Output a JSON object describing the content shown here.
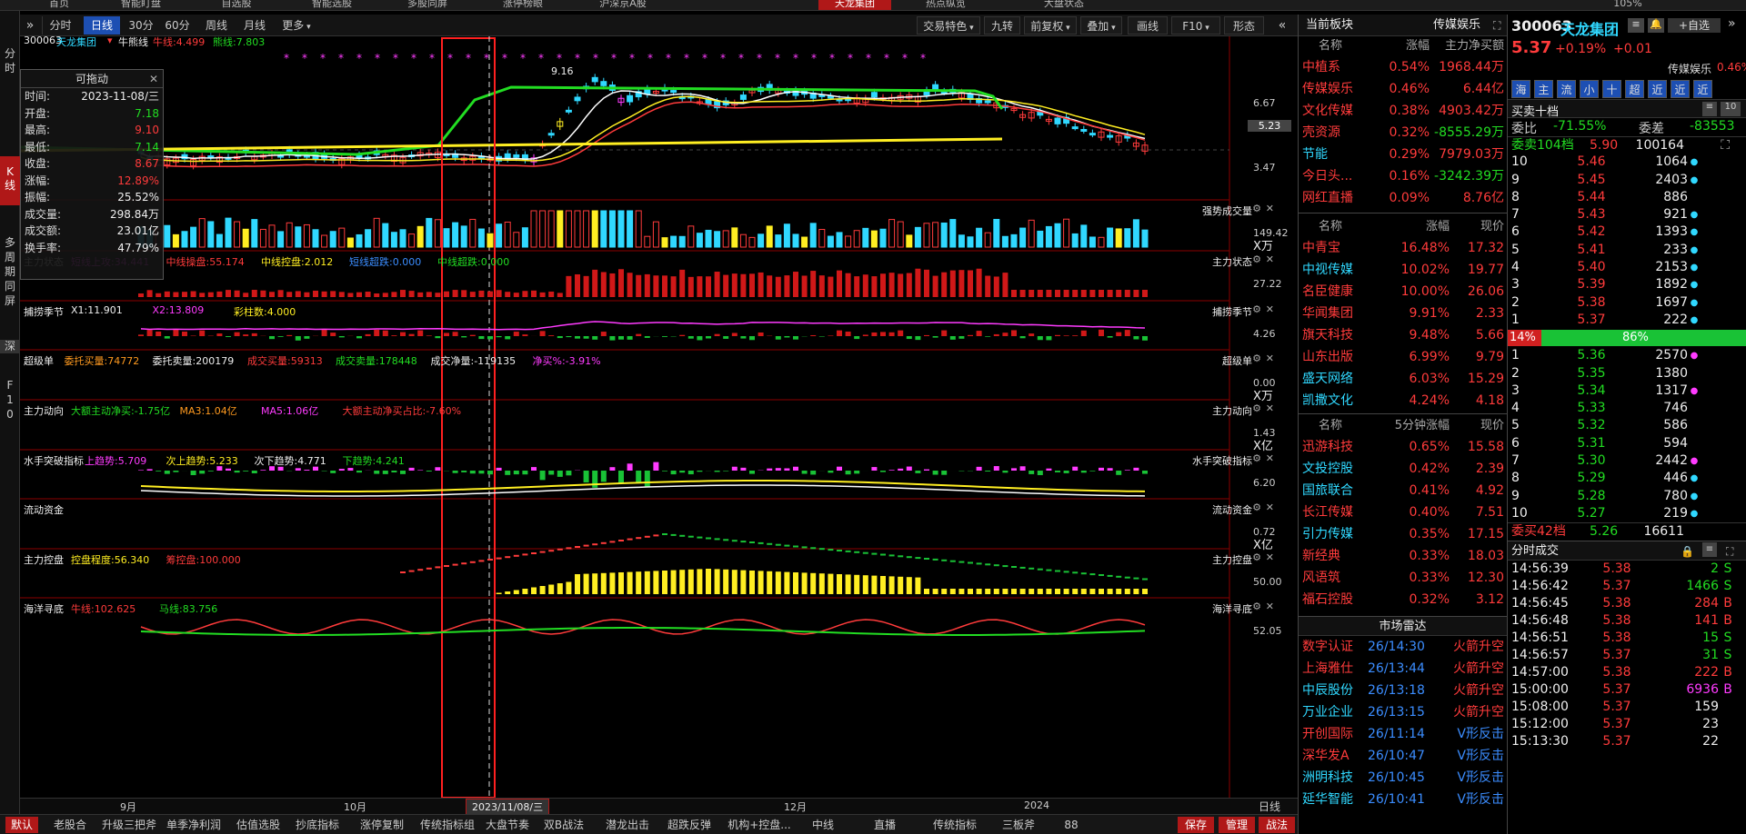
{
  "topnav": {
    "tabs": [
      "首页",
      "智能盯盘",
      "自选股",
      "智能选股",
      "多股同屏",
      "涨停榜眼",
      "沪深京A股",
      "天龙集团",
      "热点纵览",
      "大盘状态"
    ],
    "right_text": "105%"
  },
  "leftnav": {
    "items": [
      "分",
      "时",
      "K",
      "线",
      "多",
      "周",
      "期",
      "同",
      "屏",
      "深",
      "F",
      "1",
      "0"
    ]
  },
  "toolbar": {
    "expand": "»",
    "buttons": [
      "分时",
      "日线",
      "30分",
      "60分",
      "周线",
      "月线",
      "更多"
    ],
    "right": [
      "交易特色",
      "九转",
      "前复权",
      "叠加",
      "画线",
      "F10",
      "形态"
    ],
    "collapse": "«"
  },
  "chart": {
    "stock_header": {
      "code": "300063",
      "name": "天龙集团",
      "indicator": "牛熊线",
      "niu": "牛线:4.499",
      "xiong": "熊线:7.803"
    },
    "price_scale": [
      "6.67",
      "5.23",
      "3.47"
    ],
    "high_label": "9.16",
    "panels": [
      {
        "name": "强势成交量",
        "scale": [
          "149.42",
          "X万"
        ],
        "items": []
      },
      {
        "name": "主力状态",
        "scale": [
          "27.22"
        ],
        "items": [
          {
            "t": "主力状态",
            "c": "#eeeeee"
          },
          {
            "t": "短线上攻:34.441",
            "c": "#ff3bff"
          },
          {
            "t": "中线操盘:55.174",
            "c": "#ff3b3b"
          },
          {
            "t": "中线控盘:2.012",
            "c": "#ffee22"
          },
          {
            "t": "短线超跌:0.000",
            "c": "#3b8dff"
          },
          {
            "t": "中线超跌:0.000",
            "c": "#22dd22"
          }
        ]
      },
      {
        "name": "捕捞季节",
        "scale": [
          "4.26"
        ],
        "items": [
          {
            "t": "捕捞季节",
            "c": "#eeeeee"
          },
          {
            "t": "X1:11.901",
            "c": "#eeeeee"
          },
          {
            "t": "X2:13.809",
            "c": "#ff3bff"
          },
          {
            "t": "彩柱数:4.000",
            "c": "#ffee22"
          }
        ]
      },
      {
        "name": "超级单",
        "scale": [
          "0.00",
          "X万"
        ],
        "items": [
          {
            "t": "超级单",
            "c": "#eeeeee"
          },
          {
            "t": "委托买量:74772",
            "c": "#ff9a1f"
          },
          {
            "t": "委托卖量:200179",
            "c": "#eeeeee"
          },
          {
            "t": "成交买量:59313",
            "c": "#ff3b3b"
          },
          {
            "t": "成交卖量:178448",
            "c": "#22dd22"
          },
          {
            "t": "成交净量:-119135",
            "c": "#eeeeee"
          },
          {
            "t": "净买%:-3.91%",
            "c": "#ff3bff"
          }
        ]
      },
      {
        "name": "主力动向",
        "scale": [
          "1.43",
          "X亿"
        ],
        "items": [
          {
            "t": "主力动向",
            "c": "#eeeeee"
          },
          {
            "t": "大额主动净买:-1.75亿",
            "c": "#22dd22"
          },
          {
            "t": "MA3:1.04亿",
            "c": "#ff9a1f"
          },
          {
            "t": "MA5:1.06亿",
            "c": "#ff3bff"
          },
          {
            "t": "大额主动净买占比:-7.60%",
            "c": "#ff3b3b"
          }
        ]
      },
      {
        "name": "水手突破指标",
        "scale": [
          "6.20"
        ],
        "items": [
          {
            "t": "水手突破指标",
            "c": "#eeeeee"
          },
          {
            "t": "上趋势:5.709",
            "c": "#ff3bff"
          },
          {
            "t": "次上趋势:5.233",
            "c": "#ffee22"
          },
          {
            "t": "次下趋势:4.771",
            "c": "#eeeeee"
          },
          {
            "t": "下趋势:4.241",
            "c": "#22dd22"
          }
        ]
      },
      {
        "name": "流动资金",
        "scale": [
          "0.72",
          "X亿"
        ],
        "items": [
          {
            "t": "流动资金",
            "c": "#eeeeee"
          }
        ]
      },
      {
        "name": "主力控盘",
        "scale": [
          "50.00"
        ],
        "items": [
          {
            "t": "主力控盘",
            "c": "#eeeeee"
          },
          {
            "t": "控盘程度:56.340",
            "c": "#ffee22"
          },
          {
            "t": "筹控盘:100.000",
            "c": "#ff3b3b"
          }
        ]
      },
      {
        "name": "海洋寻底",
        "scale": [
          "52.05"
        ],
        "items": [
          {
            "t": "海洋寻底",
            "c": "#eeeeee"
          },
          {
            "t": "牛线:102.625",
            "c": "#ff3b3b"
          },
          {
            "t": "马线:83.756",
            "c": "#22dd22"
          }
        ]
      }
    ],
    "xaxis": [
      "9月",
      "10月",
      "2023/11/08/三",
      "12月",
      "2024"
    ]
  },
  "dragbox": {
    "title": "可拖动",
    "rows": [
      {
        "k": "时间:",
        "v": "2023-11-08/三",
        "c": "#eeeeee"
      },
      {
        "k": "开盘:",
        "v": "7.18",
        "c": "#22dd22"
      },
      {
        "k": "最高:",
        "v": "9.10",
        "c": "#ff3b3b"
      },
      {
        "k": "最低:",
        "v": "7.14",
        "c": "#22dd22"
      },
      {
        "k": "收盘:",
        "v": "8.67",
        "c": "#ff3b3b"
      },
      {
        "k": "涨幅:",
        "v": "12.89%",
        "c": "#ff3b3b"
      },
      {
        "k": "振幅:",
        "v": "25.52%",
        "c": "#eeeeee"
      },
      {
        "k": "成交量:",
        "v": "298.84万",
        "c": "#eeeeee"
      },
      {
        "k": "成交额:",
        "v": "23.01亿",
        "c": "#eeeeee"
      },
      {
        "k": "换手率:",
        "v": "47.79%",
        "c": "#eeeeee"
      }
    ]
  },
  "bottombar": {
    "right": "日线"
  },
  "funcbar": {
    "items": [
      "默认",
      "老股合",
      "升级三把斧",
      "单季净利润",
      "估值选股",
      "抄底指标",
      "涨停复制",
      "传统指标组",
      "大盘节奏",
      "双B战法",
      "潜龙出击",
      "超跌反弹",
      "机构+控盘...",
      "中线",
      "直播",
      "传统指标",
      "三板斧",
      "88"
    ],
    "right": [
      "保存",
      "管理",
      "战法"
    ]
  },
  "sector": {
    "title": "当前板块",
    "current": "传媒娱乐",
    "headers": [
      "名称",
      "涨幅",
      "主力净买额"
    ],
    "rows": [
      {
        "n": "中植系",
        "p": "0.54%",
        "v": "1968.44万",
        "nc": "#ff3b3b",
        "vc": "#ff3b3b"
      },
      {
        "n": "传媒娱乐",
        "p": "0.46%",
        "v": "6.44亿",
        "nc": "#ff3b3b",
        "vc": "#ff3b3b"
      },
      {
        "n": "文化传媒",
        "p": "0.38%",
        "v": "4903.42万",
        "nc": "#ff3b3b",
        "vc": "#ff3b3b"
      },
      {
        "n": "壳资源",
        "p": "0.32%",
        "v": "-8555.29万",
        "nc": "#ff3b3b",
        "vc": "#22dd22"
      },
      {
        "n": "节能",
        "p": "0.29%",
        "v": "7979.03万",
        "nc": "#30d8ff",
        "vc": "#ff3b3b"
      },
      {
        "n": "今日头...",
        "p": "0.16%",
        "v": "-3242.39万",
        "nc": "#ff3b3b",
        "vc": "#22dd22"
      },
      {
        "n": "网红直播",
        "p": "0.09%",
        "v": "8.76亿",
        "nc": "#ff3b3b",
        "vc": "#ff3b3b"
      }
    ]
  },
  "stocks": {
    "headers": [
      "名称",
      "涨幅",
      "现价"
    ],
    "rows": [
      {
        "n": "中青宝",
        "p": "16.48%",
        "v": "17.32",
        "nc": "#ff3b3b"
      },
      {
        "n": "中视传媒",
        "p": "10.02%",
        "v": "19.77",
        "nc": "#30d8ff"
      },
      {
        "n": "名臣健康",
        "p": "10.00%",
        "v": "26.06",
        "nc": "#ff3b3b"
      },
      {
        "n": "华闻集团",
        "p": "9.91%",
        "v": "2.33",
        "nc": "#ff3b3b"
      },
      {
        "n": "旗天科技",
        "p": "9.48%",
        "v": "5.66",
        "nc": "#ff3b3b"
      },
      {
        "n": "山东出版",
        "p": "6.99%",
        "v": "9.79",
        "nc": "#ff3b3b"
      },
      {
        "n": "盛天网络",
        "p": "6.03%",
        "v": "15.29",
        "nc": "#30d8ff"
      },
      {
        "n": "凯撒文化",
        "p": "4.24%",
        "v": "4.18",
        "nc": "#30d8ff"
      }
    ]
  },
  "fivemin": {
    "headers": [
      "名称",
      "5分钟涨幅",
      "现价"
    ],
    "rows": [
      {
        "n": "迅游科技",
        "p": "0.65%",
        "v": "15.58",
        "nc": "#ff3b3b"
      },
      {
        "n": "文投控股",
        "p": "0.42%",
        "v": "2.39",
        "nc": "#30d8ff"
      },
      {
        "n": "国旅联合",
        "p": "0.41%",
        "v": "4.92",
        "nc": "#30d8ff"
      },
      {
        "n": "长江传媒",
        "p": "0.40%",
        "v": "7.51",
        "nc": "#ff3b3b"
      },
      {
        "n": "引力传媒",
        "p": "0.35%",
        "v": "17.15",
        "nc": "#30d8ff"
      },
      {
        "n": "新经典",
        "p": "0.33%",
        "v": "18.03",
        "nc": "#ff3b3b"
      },
      {
        "n": "风语筑",
        "p": "0.33%",
        "v": "12.30",
        "nc": "#ff3b3b"
      },
      {
        "n": "福石控股",
        "p": "0.32%",
        "v": "3.12",
        "nc": "#ff3b3b"
      }
    ]
  },
  "radar": {
    "title": "市场雷达",
    "rows": [
      {
        "n": "数字认证",
        "t": "26/14:30",
        "e": "火箭升空",
        "nc": "#ff3b3b",
        "ec": "#ff3b3b"
      },
      {
        "n": "上海雅仕",
        "t": "26/13:44",
        "e": "火箭升空",
        "nc": "#ff3b3b",
        "ec": "#ff3b3b"
      },
      {
        "n": "中辰股份",
        "t": "26/13:18",
        "e": "火箭升空",
        "nc": "#30d8ff",
        "ec": "#ff3b3b"
      },
      {
        "n": "万业企业",
        "t": "26/13:15",
        "e": "火箭升空",
        "nc": "#30d8ff",
        "ec": "#ff3b3b"
      },
      {
        "n": "开创国际",
        "t": "26/11:14",
        "e": "V形反击",
        "nc": "#ff3b3b",
        "ec": "#3b8dff"
      },
      {
        "n": "深华发A",
        "t": "26/10:47",
        "e": "V形反击",
        "nc": "#ff3b3b",
        "ec": "#3b8dff"
      },
      {
        "n": "洲明科技",
        "t": "26/10:45",
        "e": "V形反击",
        "nc": "#30d8ff",
        "ec": "#3b8dff"
      },
      {
        "n": "延华智能",
        "t": "26/10:41",
        "e": "V形反击",
        "nc": "#30d8ff",
        "ec": "#3b8dff"
      }
    ]
  },
  "quote": {
    "code": "300063",
    "name": "天龙集团",
    "price": "5.37",
    "change_pct": "+0.19%",
    "change": "+0.01",
    "sector": "传媒娱乐",
    "sector_pct": "0.46%",
    "add": "+自选",
    "mini_buttons": [
      "海",
      "主",
      "流",
      "小",
      "十",
      "超",
      "近",
      "近",
      "近"
    ],
    "tenlevel": "买卖十档",
    "weibi_k": "委比",
    "weibi": "-71.55%",
    "weicha_k": "委差",
    "weicha": "-83553",
    "sell_summary": {
      "k": "委卖104档",
      "p": "5.90",
      "v": "100164"
    },
    "sells": [
      {
        "l": "10",
        "p": "5.46",
        "v": "1064"
      },
      {
        "l": "9",
        "p": "5.45",
        "v": "2403"
      },
      {
        "l": "8",
        "p": "5.44",
        "v": "886"
      },
      {
        "l": "7",
        "p": "5.43",
        "v": "921"
      },
      {
        "l": "6",
        "p": "5.42",
        "v": "1393"
      },
      {
        "l": "5",
        "p": "5.41",
        "v": "233"
      },
      {
        "l": "4",
        "p": "5.40",
        "v": "2153"
      },
      {
        "l": "3",
        "p": "5.39",
        "v": "1892"
      },
      {
        "l": "2",
        "p": "5.38",
        "v": "1697"
      },
      {
        "l": "1",
        "p": "5.37",
        "v": "222"
      }
    ],
    "ratio_left": "14%",
    "ratio_right": "86%",
    "buys": [
      {
        "l": "1",
        "p": "5.36",
        "v": "2570"
      },
      {
        "l": "2",
        "p": "5.35",
        "v": "1380"
      },
      {
        "l": "3",
        "p": "5.34",
        "v": "1317"
      },
      {
        "l": "4",
        "p": "5.33",
        "v": "746"
      },
      {
        "l": "5",
        "p": "5.32",
        "v": "586"
      },
      {
        "l": "6",
        "p": "5.31",
        "v": "594"
      },
      {
        "l": "7",
        "p": "5.30",
        "v": "2442"
      },
      {
        "l": "8",
        "p": "5.29",
        "v": "446"
      },
      {
        "l": "9",
        "p": "5.28",
        "v": "780"
      },
      {
        "l": "10",
        "p": "5.27",
        "v": "219"
      }
    ],
    "buy_summary": {
      "k": "委买42档",
      "p": "5.26",
      "v": "16611"
    }
  },
  "trades": {
    "title": "分时成交",
    "rows": [
      {
        "t": "14:56:39",
        "p": "5.38",
        "v": "2",
        "s": "S",
        "pc": "#ff3b3b",
        "vc": "#22dd22"
      },
      {
        "t": "14:56:42",
        "p": "5.37",
        "v": "1466",
        "s": "S",
        "pc": "#ff3b3b",
        "vc": "#22dd22"
      },
      {
        "t": "14:56:45",
        "p": "5.38",
        "v": "284",
        "s": "B",
        "pc": "#ff3b3b",
        "vc": "#ff3b3b"
      },
      {
        "t": "14:56:48",
        "p": "5.38",
        "v": "141",
        "s": "B",
        "pc": "#ff3b3b",
        "vc": "#ff3b3b"
      },
      {
        "t": "14:56:51",
        "p": "5.38",
        "v": "15",
        "s": "S",
        "pc": "#ff3b3b",
        "vc": "#22dd22"
      },
      {
        "t": "14:56:57",
        "p": "5.37",
        "v": "31",
        "s": "S",
        "pc": "#ff3b3b",
        "vc": "#22dd22"
      },
      {
        "t": "14:57:00",
        "p": "5.38",
        "v": "222",
        "s": "B",
        "pc": "#ff3b3b",
        "vc": "#ff3b3b"
      },
      {
        "t": "15:00:00",
        "p": "5.37",
        "v": "6936",
        "s": "B",
        "pc": "#ff3b3b",
        "vc": "#ff3bff"
      },
      {
        "t": "15:08:00",
        "p": "5.37",
        "v": "159",
        "s": "",
        "pc": "#ff3b3b",
        "vc": "#eeeeee"
      },
      {
        "t": "15:12:00",
        "p": "5.37",
        "v": "23",
        "s": "",
        "pc": "#ff3b3b",
        "vc": "#eeeeee"
      },
      {
        "t": "15:13:30",
        "p": "5.37",
        "v": "22",
        "s": "",
        "pc": "#ff3b3b",
        "vc": "#eeeeee"
      }
    ]
  }
}
